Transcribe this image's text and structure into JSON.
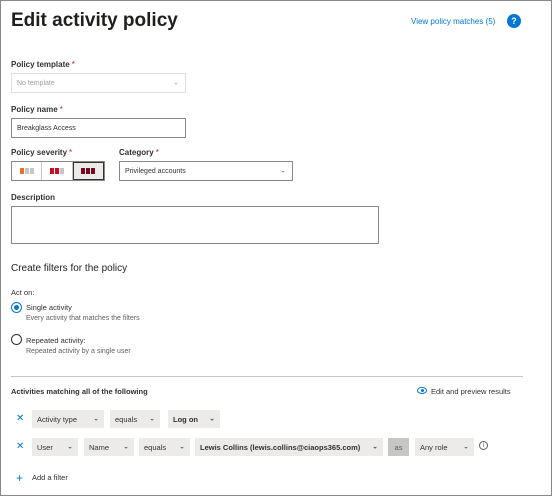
{
  "header": {
    "title": "Edit activity policy",
    "view_matches": "View policy matches (5)",
    "help_glyph": "?"
  },
  "form": {
    "template_label": "Policy template",
    "template_placeholder": "No template",
    "name_label": "Policy name",
    "name_value": "Breakglass Access",
    "severity_label": "Policy severity",
    "severity_options": [
      "low",
      "medium",
      "high"
    ],
    "severity_selected": "high",
    "category_label": "Category",
    "category_value": "Privileged accounts",
    "description_label": "Description",
    "description_value": "",
    "required_mark": "*"
  },
  "filters": {
    "section_title": "Create filters for the policy",
    "act_on_label": "Act on:",
    "single_label": "Single activity",
    "single_sub": "Every activity that matches the filters",
    "repeated_label": "Repeated activity:",
    "repeated_sub": "Repeated activity by a single user",
    "selected": "single",
    "matching_label": "Activities matching all of the following",
    "edit_preview": "Edit and preview results",
    "row1": {
      "field": "Activity type",
      "op": "equals",
      "value": "Log on"
    },
    "row2": {
      "field": "User",
      "subfield": "Name",
      "op": "equals",
      "value": "Lewis Collins (lewis.collins@ciaops365.com)",
      "as": "as",
      "role": "Any role"
    },
    "add_filter": "Add a filter",
    "remove_glyph": "✕",
    "add_glyph": "+",
    "info_glyph": "i",
    "chevron_glyph": "⌄"
  },
  "colors": {
    "accent": "#0078d4",
    "severity_low": "#e8702a",
    "severity_medium": "#c50f1f",
    "severity_high": "#750b1c"
  }
}
